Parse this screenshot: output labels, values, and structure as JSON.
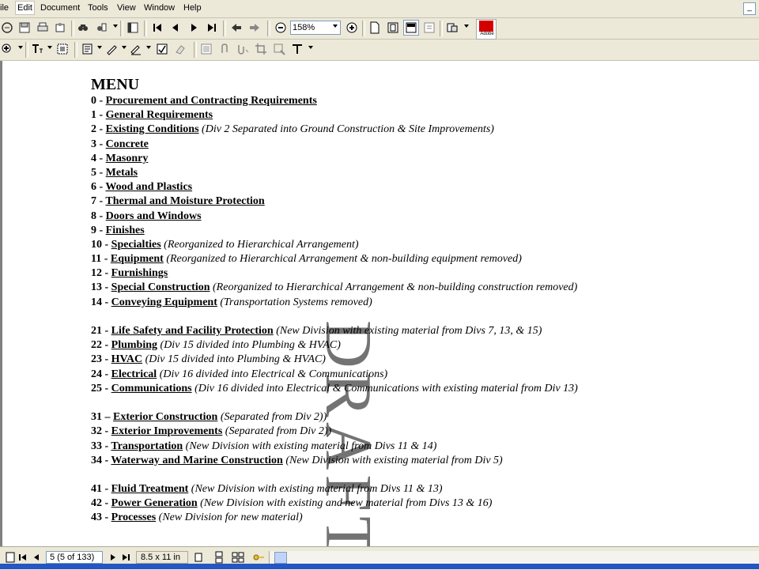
{
  "menubar": {
    "items": [
      "ile",
      "Edit",
      "Document",
      "Tools",
      "View",
      "Window",
      "Help"
    ],
    "restore_glyph": "_"
  },
  "toolbar": {
    "zoom_value": "158%",
    "adobe_label": "Adobe"
  },
  "document": {
    "menu_title": "MENU",
    "watermark": "DRAFT",
    "entries": [
      {
        "num": "0 - ",
        "title": "Procurement and Contracting Requirements",
        "note": ""
      },
      {
        "num": "1 - ",
        "title": "General Requirements",
        "note": ""
      },
      {
        "num": "2 - ",
        "title": "Existing Conditions",
        "note": " (Div 2 Separated into Ground Construction & Site Improvements)"
      },
      {
        "num": "3 - ",
        "title": "Concrete",
        "note": ""
      },
      {
        "num": "4 - ",
        "title": "Masonry",
        "note": ""
      },
      {
        "num": "5 - ",
        "title": "Metals",
        "note": ""
      },
      {
        "num": "6 - ",
        "title": "Wood and Plastics",
        "note": ""
      },
      {
        "num": "7 - ",
        "title": "Thermal and Moisture Protection",
        "note": ""
      },
      {
        "num": "8 - ",
        "title": "Doors and Windows",
        "note": ""
      },
      {
        "num": "9 - ",
        "title": "Finishes",
        "note": ""
      },
      {
        "num": "10 - ",
        "title": "Specialties",
        "note": " (Reorganized to Hierarchical Arrangement)"
      },
      {
        "num": "11 - ",
        "title": "Equipment",
        "note": " (Reorganized to Hierarchical Arrangement & non-building equipment removed)"
      },
      {
        "num": "12 - ",
        "title": "Furnishings",
        "note": ""
      },
      {
        "num": "13 - ",
        "title": "Special Construction",
        "note": " (Reorganized to Hierarchical Arrangement & non-building construction removed)"
      },
      {
        "num": "14 - ",
        "title": "Conveying Equipment",
        "note": " (Transportation Systems removed)"
      },
      {
        "gap": true
      },
      {
        "num": "21 - ",
        "title": "Life Safety and Facility Protection",
        "note": " (New Division with existing material from Divs 7, 13, & 15)"
      },
      {
        "num": "22 - ",
        "title": "Plumbing",
        "note": " (Div 15 divided into Plumbing & HVAC)"
      },
      {
        "num": "23 - ",
        "title": "HVAC",
        "note": " (Div 15 divided into Plumbing & HVAC)"
      },
      {
        "num": "24 - ",
        "title": "Electrical",
        "note": " (Div 16 divided into Electrical & Communications)"
      },
      {
        "num": "25 - ",
        "title": "Communications",
        "note": " (Div 16 divided into Electrical & Communications with existing material from Div 13)"
      },
      {
        "gap": true
      },
      {
        "num": "31 – ",
        "title": "Exterior Construction",
        "note": " (Separated from Div 2))"
      },
      {
        "num": "32 - ",
        "title": "Exterior Improvements",
        "note": " (Separated from Div 2))"
      },
      {
        "num": "33 - ",
        "title": "Transportation",
        "note": " (New Division with existing material from Divs 11 & 14)"
      },
      {
        "num": "34 - ",
        "title": "Waterway and Marine Construction",
        "note": " (New Division with existing material from Div 5)"
      },
      {
        "gap": true
      },
      {
        "num": "41 - ",
        "title": "Fluid Treatment",
        "note": " (New Division with existing material from Divs 11 & 13)"
      },
      {
        "num": "42 - ",
        "title": "Power Generation",
        "note": " (New Division with existing and new material from Divs 13 & 16)"
      },
      {
        "num": "43 - ",
        "title": "Processes",
        "note": " (New Division for new material)"
      }
    ]
  },
  "statusbar": {
    "page_field": "5  (5 of 133)",
    "page_size": "8.5 x 11 in"
  },
  "colors": {
    "chrome": "#ece9d8",
    "taskbar": "#2456c4",
    "adobe_red": "#d40000"
  }
}
